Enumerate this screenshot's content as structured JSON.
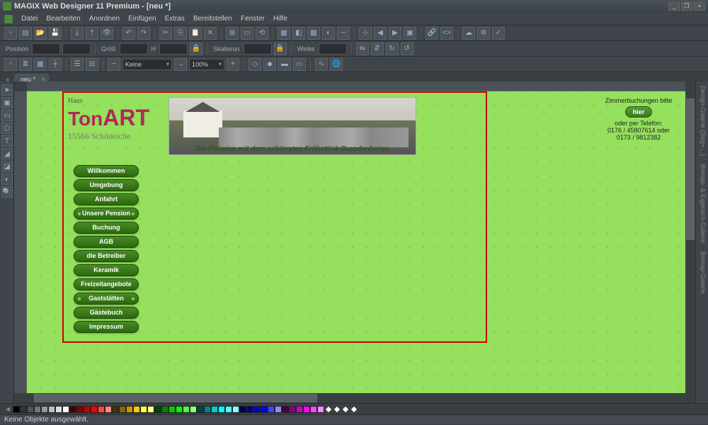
{
  "app": {
    "title": "MAGIX Web Designer 11 Premium - [neu *]"
  },
  "menu": {
    "items": [
      "Datei",
      "Bearbeiten",
      "Anordnen",
      "Einfügen",
      "Extras",
      "Bereitstellen",
      "Fenster",
      "Hilfe"
    ]
  },
  "toolbar2": {
    "pos_label": "Position",
    "size_label": "Größ",
    "size_unit": "H",
    "scale_label": "Skalierun",
    "angle_label": "Winke",
    "x": "",
    "y": "",
    "w": "",
    "h": "",
    "scale": "",
    "angle": ""
  },
  "toolbar3": {
    "linestyle": "Keine",
    "zoom": "100%"
  },
  "tab": {
    "name": "neu *"
  },
  "right_panels": [
    "Design-Galerie (Strg+…)",
    "Bitmap- & Eigensch-Galerie",
    "Bitmap-Galerie"
  ],
  "site": {
    "logo_pre": "Haus",
    "logo_ton": "Ton",
    "logo_art": "ART",
    "logo_zip": "15566 Schöneiche.",
    "banner_slogan": "Die Pension mit dem schönsten Frühstück Brandenburgs",
    "contact_title": "Zimmerbuchungen bitte",
    "contact_btn": "hier",
    "contact_l1": "oder per Telefon:",
    "contact_l2": "0176 / 45807614 oder",
    "contact_l3": "0173 / 9812382",
    "nav": [
      {
        "label": "Willkommen",
        "sub": false
      },
      {
        "label": "Umgebung",
        "sub": false
      },
      {
        "label": "Anfahrt",
        "sub": false
      },
      {
        "label": "Unsere Pension",
        "sub": true
      },
      {
        "label": "Buchung",
        "sub": false
      },
      {
        "label": "AGB",
        "sub": false
      },
      {
        "label": "die Betreiber",
        "sub": false
      },
      {
        "label": "Keramik",
        "sub": false
      },
      {
        "label": "Freizeitangebote",
        "sub": false
      },
      {
        "label": "Gaststätten",
        "sub": true
      },
      {
        "label": "Gästebuch",
        "sub": false
      },
      {
        "label": "Impressum",
        "sub": false
      }
    ]
  },
  "palette_colors": [
    "#000",
    "#333",
    "#555",
    "#777",
    "#999",
    "#bbb",
    "#ddd",
    "#fff",
    "#400",
    "#800",
    "#c00",
    "#f00",
    "#f44",
    "#f88",
    "#430",
    "#860",
    "#c90",
    "#fc0",
    "#ff4",
    "#ff8",
    "#040",
    "#080",
    "#0c0",
    "#0f0",
    "#4f4",
    "#8f8",
    "#044",
    "#088",
    "#0cc",
    "#0ff",
    "#4ff",
    "#8ff",
    "#004",
    "#008",
    "#00c",
    "#00f",
    "#44f",
    "#88f",
    "#404",
    "#808",
    "#c0c",
    "#f0f",
    "#f4f",
    "#f8f"
  ],
  "status": "Keine Objekte ausgewählt."
}
